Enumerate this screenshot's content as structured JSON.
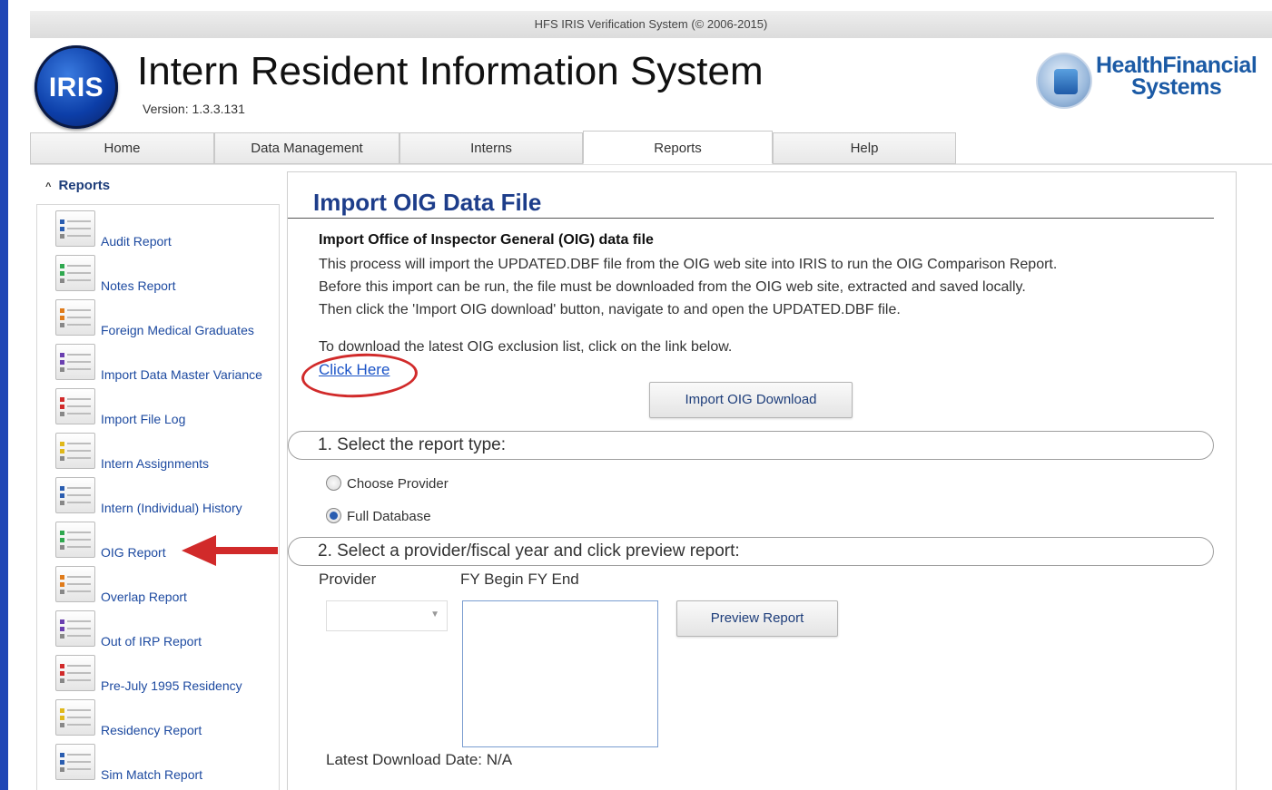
{
  "window": {
    "title": "HFS IRIS Verification System (© 2006-2015)"
  },
  "header": {
    "logo_text": "IRIS",
    "app_title": "Intern Resident Information System",
    "version": "Version: 1.3.3.131",
    "company_line1": "HealthFinancial",
    "company_line2": "Systems"
  },
  "tabs": [
    {
      "label": "Home"
    },
    {
      "label": "Data Management"
    },
    {
      "label": "Interns"
    },
    {
      "label": "Reports"
    },
    {
      "label": "Help"
    }
  ],
  "active_tab": "Reports",
  "sidebar": {
    "header": "Reports",
    "items": [
      {
        "label": "Audit Report",
        "color": "#2a5db0"
      },
      {
        "label": "Notes Report",
        "color": "#2fa84f"
      },
      {
        "label": "Foreign Medical Graduates",
        "color": "#e07b1a"
      },
      {
        "label": "Import Data Master Variance",
        "color": "#6a3fb0"
      },
      {
        "label": "Import File Log",
        "color": "#d12a2a"
      },
      {
        "label": "Intern Assignments",
        "color": "#e0b81a"
      },
      {
        "label": "Intern (Individual) History",
        "color": "#2a5db0"
      },
      {
        "label": "OIG Report",
        "color": "#2fa84f"
      },
      {
        "label": "Overlap Report",
        "color": "#e07b1a"
      },
      {
        "label": "Out of IRP Report",
        "color": "#6a3fb0"
      },
      {
        "label": "Pre-July 1995 Residency",
        "color": "#d12a2a"
      },
      {
        "label": "Residency Report",
        "color": "#e0b81a"
      },
      {
        "label": "Sim Match Report",
        "color": "#2a5db0"
      }
    ]
  },
  "main": {
    "title": "Import OIG Data File",
    "desc_heading": "Import Office of Inspector General (OIG) data file",
    "desc_lines": [
      "This process will import the UPDATED.DBF file from the OIG web site into IRIS to run the OIG Comparison Report.",
      "Before this import can be run, the file must be downloaded from the OIG web site, extracted and saved locally.",
      "Then click the 'Import OIG download' button, navigate to and open the UPDATED.DBF file."
    ],
    "download_prompt": "To download the latest OIG exclusion list, click on the link below.",
    "click_here": "Click Here",
    "import_button": "Import OIG Download",
    "section1": "1. Select the report type:",
    "radio_options": [
      {
        "label": "Choose Provider",
        "checked": false
      },
      {
        "label": "Full Database",
        "checked": true
      }
    ],
    "section2": "2. Select a provider/fiscal year and click preview report:",
    "provider_label": "Provider",
    "fy_label": "FY Begin  FY End",
    "provider_value": "",
    "preview_button": "Preview Report",
    "latest_download": "Latest Download Date: N/A"
  },
  "annotation_color": "#d12a2a"
}
